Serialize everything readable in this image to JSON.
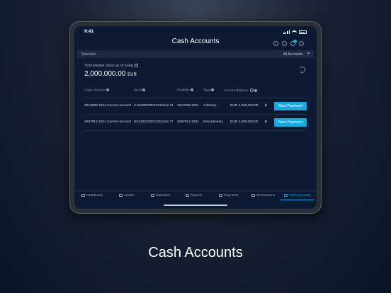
{
  "status": {
    "time": "9:41"
  },
  "header": {
    "title": "Cash Accounts"
  },
  "selection": {
    "label": "Selection",
    "value": "All Accounts"
  },
  "summary": {
    "label": "Total Market Value as of today",
    "value": "2,000,000.00",
    "currency": "EUR"
  },
  "table": {
    "columns": [
      "Cash Account",
      "IBAN",
      "Portfolio",
      "Type",
      "Current Balance"
    ],
    "rows": [
      {
        "account": "4012899.1001 Current account",
        "iban": "CH1100220012312312 31",
        "portfolio": "4012899.1001",
        "type": "Advisory",
        "balance": "EUR 1,000,000.00",
        "action": "New Payment"
      },
      {
        "account": "4067813.1001 Current account",
        "iban": "EU1100220012312312 77",
        "portfolio": "4067813.1001",
        "type": "Discretionary",
        "balance": "EUR 1,000,000.00",
        "action": "New Payment"
      }
    ]
  },
  "tabs": [
    {
      "label": "Dashboard",
      "icon": "dashboard-icon"
    },
    {
      "label": "Assets",
      "icon": "assets-icon"
    },
    {
      "label": "Maturities",
      "icon": "maturities-icon"
    },
    {
      "label": "Reports",
      "icon": "reports-icon"
    },
    {
      "label": "Payments",
      "icon": "payments-icon"
    },
    {
      "label": "Transactions",
      "icon": "transactions-icon"
    },
    {
      "label": "Cash Accounts",
      "icon": "cash-accounts-icon"
    }
  ],
  "caption": "Cash Accounts",
  "colors": {
    "accent": "#1aa8e0",
    "background": "#0c1a33"
  }
}
